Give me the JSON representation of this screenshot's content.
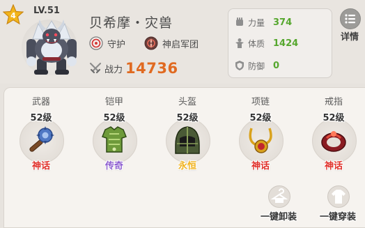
{
  "hero": {
    "star_count": "4",
    "level": "LV.51",
    "name": "贝希摩・灾兽",
    "traits": [
      {
        "icon": "guard-target-icon",
        "label": "守护"
      },
      {
        "icon": "faction-emblem-icon",
        "label": "神启军团"
      }
    ],
    "power_label": "战力",
    "power_value": "14736"
  },
  "stats": [
    {
      "icon": "fist-icon",
      "label": "力量",
      "value": "374"
    },
    {
      "icon": "body-icon",
      "label": "体质",
      "value": "1424"
    },
    {
      "icon": "shield-icon",
      "label": "防御",
      "value": "0"
    }
  ],
  "detail_button": {
    "label": "详情"
  },
  "equipment": [
    {
      "slot": "武器",
      "level": "52级",
      "item_icon": "mace-icon",
      "quality": "神话",
      "quality_color": "#e0302a"
    },
    {
      "slot": "铠甲",
      "level": "52级",
      "item_icon": "armor-icon",
      "quality": "传奇",
      "quality_color": "#8e5fd0"
    },
    {
      "slot": "头盔",
      "level": "52级",
      "item_icon": "helmet-icon",
      "quality": "永恒",
      "quality_color": "#f0b320"
    },
    {
      "slot": "项链",
      "level": "52级",
      "item_icon": "necklace-icon",
      "quality": "神话",
      "quality_color": "#e0302a"
    },
    {
      "slot": "戒指",
      "level": "52级",
      "item_icon": "ring-icon",
      "quality": "神话",
      "quality_color": "#e0302a"
    }
  ],
  "actions": {
    "unequip_all": "一键卸装",
    "equip_all": "一键穿装"
  },
  "colors": {
    "power": "#e06a21",
    "stat_value": "#56a72e",
    "mythic": "#e0302a",
    "legendary": "#8e5fd0",
    "eternal": "#f0b320"
  }
}
